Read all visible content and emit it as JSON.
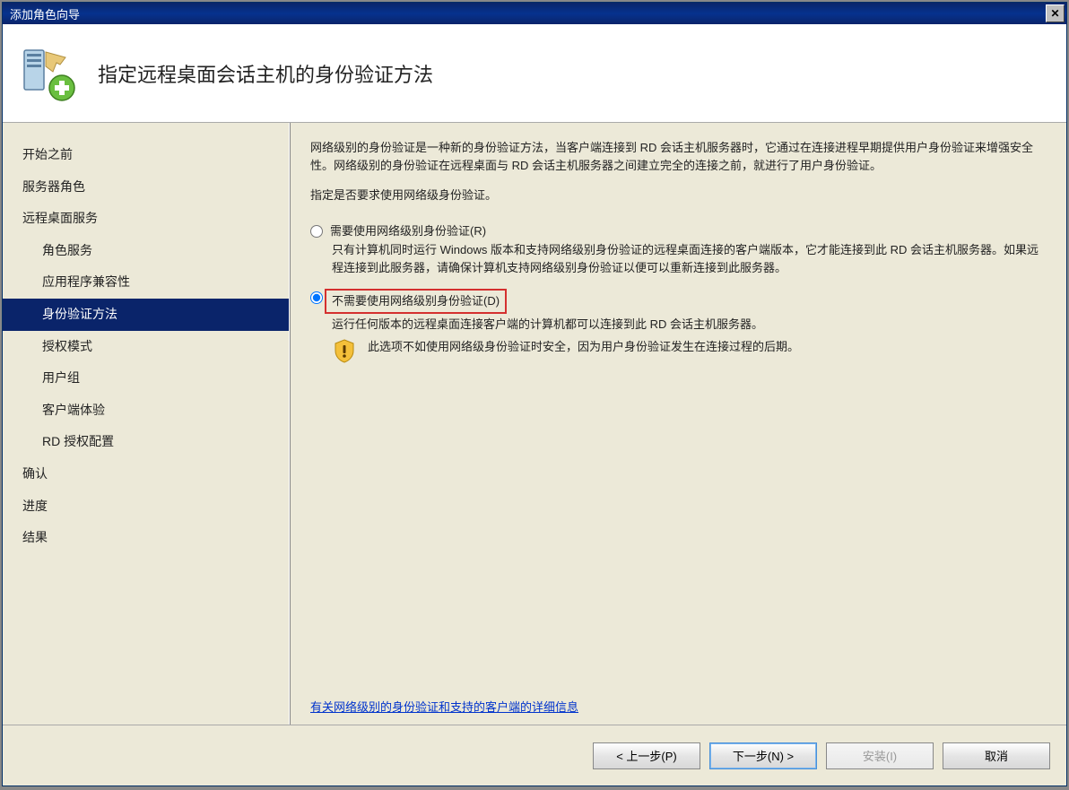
{
  "window": {
    "title": "添加角色向导"
  },
  "header": {
    "title": "指定远程桌面会话主机的身份验证方法"
  },
  "sidebar": {
    "items": [
      {
        "label": "开始之前",
        "sub": false
      },
      {
        "label": "服务器角色",
        "sub": false
      },
      {
        "label": "远程桌面服务",
        "sub": false
      },
      {
        "label": "角色服务",
        "sub": true
      },
      {
        "label": "应用程序兼容性",
        "sub": true
      },
      {
        "label": "身份验证方法",
        "sub": true,
        "selected": true
      },
      {
        "label": "授权模式",
        "sub": true
      },
      {
        "label": "用户组",
        "sub": true
      },
      {
        "label": "客户端体验",
        "sub": true
      },
      {
        "label": "RD 授权配置",
        "sub": true
      },
      {
        "label": "确认",
        "sub": false
      },
      {
        "label": "进度",
        "sub": false
      },
      {
        "label": "结果",
        "sub": false
      }
    ]
  },
  "content": {
    "description": "网络级别的身份验证是一种新的身份验证方法，当客户端连接到 RD 会话主机服务器时，它通过在连接进程早期提供用户身份验证来增强安全性。网络级别的身份验证在远程桌面与 RD 会话主机服务器之间建立完全的连接之前，就进行了用户身份验证。",
    "instruction": "指定是否要求使用网络级身份验证。",
    "radio1": {
      "label": "需要使用网络级别身份验证(R)",
      "desc": "只有计算机同时运行 Windows 版本和支持网络级别身份验证的远程桌面连接的客户端版本，它才能连接到此 RD 会话主机服务器。如果远程连接到此服务器，请确保计算机支持网络级别身份验证以便可以重新连接到此服务器。"
    },
    "radio2": {
      "label": "不需要使用网络级别身份验证(D)",
      "desc": "运行任何版本的远程桌面连接客户端的计算机都可以连接到此 RD 会话主机服务器。",
      "warning": "此选项不如使用网络级身份验证时安全，因为用户身份验证发生在连接过程的后期。"
    },
    "more_link": "有关网络级别的身份验证和支持的客户端的详细信息"
  },
  "footer": {
    "prev": "< 上一步(P)",
    "next": "下一步(N) >",
    "install": "安装(I)",
    "cancel": "取消"
  }
}
